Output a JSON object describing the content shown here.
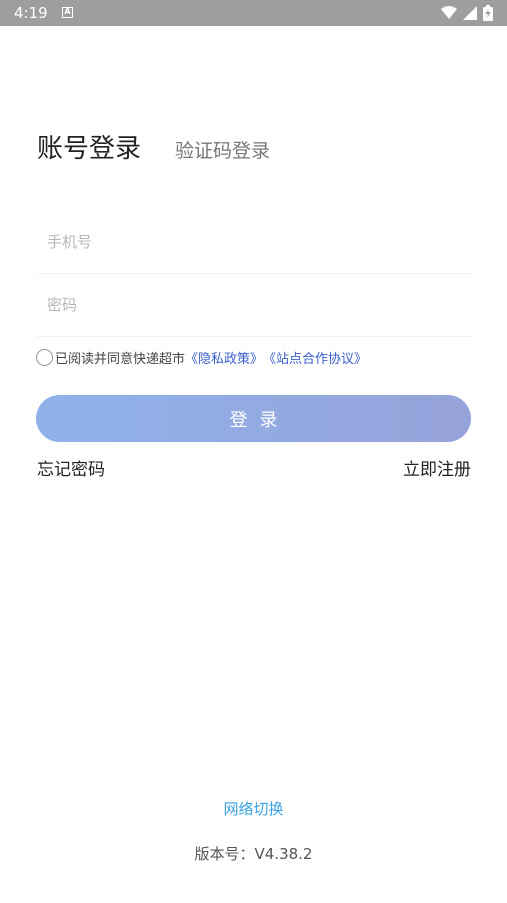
{
  "status_bar": {
    "time": "4:19",
    "notification_letter": "A",
    "icons": [
      "wifi-icon",
      "signal-icon",
      "battery-charging-icon"
    ]
  },
  "tabs": {
    "account_login": "账号登录",
    "code_login": "验证码登录"
  },
  "form": {
    "phone_placeholder": "手机号",
    "password_placeholder": "密码"
  },
  "agreement": {
    "text": "已阅读并同意快递超市",
    "privacy_link": "《隐私政策》",
    "cooperation_link": "《站点合作协议》"
  },
  "buttons": {
    "login": "登录",
    "forgot_password": "忘记密码",
    "register": "立即注册"
  },
  "footer": {
    "network_switch": "网络切换",
    "version": "版本号：V4.38.2"
  },
  "colors": {
    "button_gradient_start": "#8fb2ea",
    "button_gradient_end": "#96a3da",
    "link": "#3a5fcd",
    "network_link": "#3aa2e0",
    "status_bar": "#9e9e9e"
  }
}
